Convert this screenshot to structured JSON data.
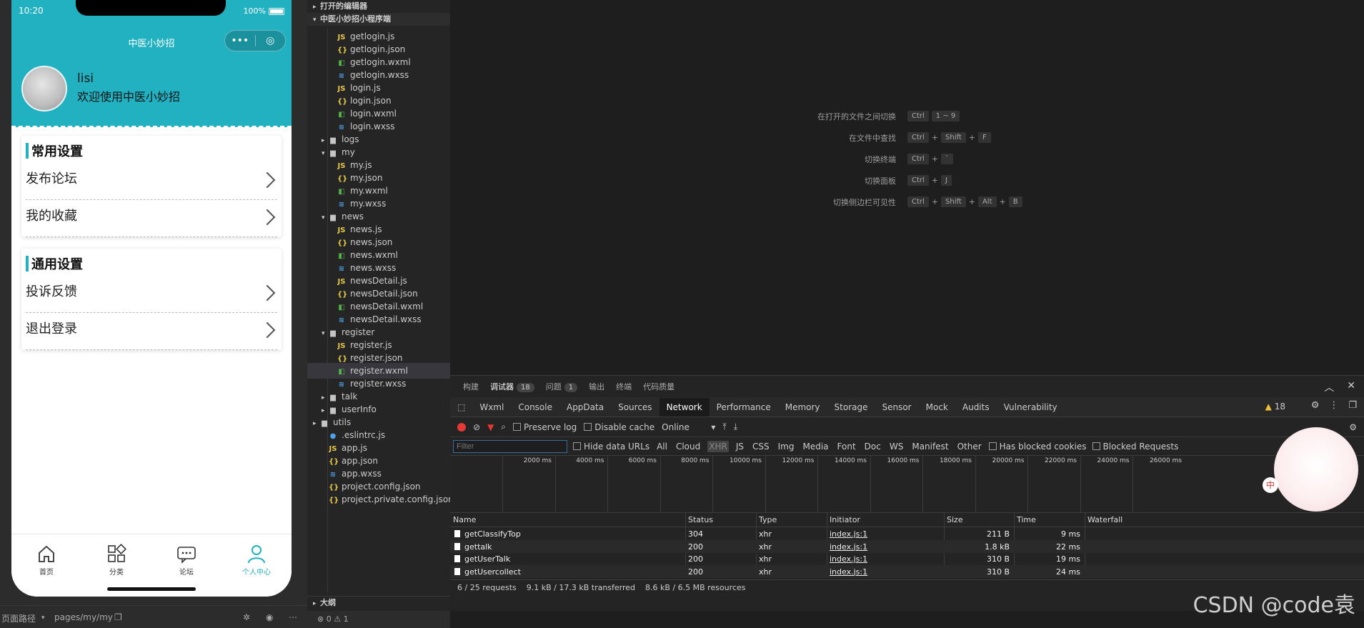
{
  "status_bar": {
    "time": "10:20",
    "battery": "100%"
  },
  "nav": {
    "title": "中医小妙招"
  },
  "profile": {
    "username": "lisi",
    "welcome": "欢迎使用中医小妙招"
  },
  "sections": [
    {
      "title": "常用设置",
      "items": [
        "发布论坛",
        "我的收藏"
      ]
    },
    {
      "title": "通用设置",
      "items": [
        "投诉反馈",
        "退出登录"
      ]
    }
  ],
  "tabs": [
    {
      "label": "首页",
      "icon": "home-icon"
    },
    {
      "label": "分类",
      "icon": "category-icon"
    },
    {
      "label": "论坛",
      "icon": "forum-icon"
    },
    {
      "label": "个人中心",
      "icon": "user-icon",
      "active": true
    }
  ],
  "sim_footer": {
    "path_label": "页面路径",
    "path": "pages/my/my"
  },
  "explorer": {
    "open_editors": "打开的编辑器",
    "project": "中医小妙招小程序端",
    "outline": "大纲",
    "items": [
      {
        "name": "getlogin.js",
        "type": "js",
        "indent": 2
      },
      {
        "name": "getlogin.json",
        "type": "json",
        "indent": 2
      },
      {
        "name": "getlogin.wxml",
        "type": "wxml",
        "indent": 2
      },
      {
        "name": "getlogin.wxss",
        "type": "wxss",
        "indent": 2
      },
      {
        "name": "login.js",
        "type": "js",
        "indent": 2
      },
      {
        "name": "login.json",
        "type": "json",
        "indent": 2
      },
      {
        "name": "login.wxml",
        "type": "wxml",
        "indent": 2
      },
      {
        "name": "login.wxss",
        "type": "wxss",
        "indent": 2
      },
      {
        "name": "logs",
        "type": "folder",
        "indent": 1,
        "open": false
      },
      {
        "name": "my",
        "type": "folder",
        "indent": 1,
        "open": true
      },
      {
        "name": "my.js",
        "type": "js",
        "indent": 2
      },
      {
        "name": "my.json",
        "type": "json",
        "indent": 2
      },
      {
        "name": "my.wxml",
        "type": "wxml",
        "indent": 2
      },
      {
        "name": "my.wxss",
        "type": "wxss",
        "indent": 2
      },
      {
        "name": "news",
        "type": "folder",
        "indent": 1,
        "open": true
      },
      {
        "name": "news.js",
        "type": "js",
        "indent": 2
      },
      {
        "name": "news.json",
        "type": "json",
        "indent": 2
      },
      {
        "name": "news.wxml",
        "type": "wxml",
        "indent": 2
      },
      {
        "name": "news.wxss",
        "type": "wxss",
        "indent": 2
      },
      {
        "name": "newsDetail.js",
        "type": "js",
        "indent": 2
      },
      {
        "name": "newsDetail.json",
        "type": "json",
        "indent": 2
      },
      {
        "name": "newsDetail.wxml",
        "type": "wxml",
        "indent": 2
      },
      {
        "name": "newsDetail.wxss",
        "type": "wxss",
        "indent": 2
      },
      {
        "name": "register",
        "type": "folder",
        "indent": 1,
        "open": true
      },
      {
        "name": "register.js",
        "type": "js",
        "indent": 2
      },
      {
        "name": "register.json",
        "type": "json",
        "indent": 2
      },
      {
        "name": "register.wxml",
        "type": "wxml",
        "indent": 2,
        "selected": true
      },
      {
        "name": "register.wxss",
        "type": "wxss",
        "indent": 2
      },
      {
        "name": "talk",
        "type": "folder",
        "indent": 1,
        "open": false
      },
      {
        "name": "userInfo",
        "type": "folder",
        "indent": 1,
        "open": false
      },
      {
        "name": "utils",
        "type": "folder",
        "indent": 0,
        "open": false
      },
      {
        "name": ".eslintrc.js",
        "type": "eslint",
        "indent": 1
      },
      {
        "name": "app.js",
        "type": "js",
        "indent": 1
      },
      {
        "name": "app.json",
        "type": "json",
        "indent": 1
      },
      {
        "name": "app.wxss",
        "type": "wxss",
        "indent": 1
      },
      {
        "name": "project.config.json",
        "type": "json",
        "indent": 1
      },
      {
        "name": "project.private.config.json",
        "type": "json",
        "indent": 1
      }
    ],
    "footer": "⊗ 0 ⚠ 1"
  },
  "shortcuts": [
    {
      "label": "在打开的文件之间切换",
      "keys": [
        "Ctrl",
        "1 ~ 9"
      ]
    },
    {
      "label": "在文件中查找",
      "keys": [
        "Ctrl",
        "+",
        "Shift",
        "+",
        "F"
      ]
    },
    {
      "label": "切换终端",
      "keys": [
        "Ctrl",
        "+",
        "`"
      ]
    },
    {
      "label": "切换面板",
      "keys": [
        "Ctrl",
        "+",
        "J"
      ]
    },
    {
      "label": "切换侧边栏可见性",
      "keys": [
        "Ctrl",
        "+",
        "Shift",
        "+",
        "Alt",
        "+",
        "B"
      ]
    }
  ],
  "devtools": {
    "top_tabs": [
      "构建",
      "调试器",
      "问题",
      "输出",
      "终端",
      "代码质量"
    ],
    "debugger_count": "18",
    "issues_count": "1",
    "panel_tabs": [
      "Wxml",
      "Console",
      "AppData",
      "Sources",
      "Network",
      "Performance",
      "Memory",
      "Storage",
      "Sensor",
      "Mock",
      "Audits",
      "Vulnerability"
    ],
    "active_panel": "Network",
    "warnings": "18",
    "preserve_log": "Preserve log",
    "disable_cache": "Disable cache",
    "throttle": "Online",
    "filter_placeholder": "Filter",
    "hide_data_urls": "Hide data URLs",
    "types": [
      "All",
      "Cloud",
      "XHR",
      "JS",
      "CSS",
      "Img",
      "Media",
      "Font",
      "Doc",
      "WS",
      "Manifest",
      "Other"
    ],
    "has_blocked": "Has blocked cookies",
    "blocked_requests": "Blocked Requests",
    "ticks": [
      "2000 ms",
      "4000 ms",
      "6000 ms",
      "8000 ms",
      "10000 ms",
      "12000 ms",
      "14000 ms",
      "16000 ms",
      "18000 ms",
      "20000 ms",
      "22000 ms",
      "24000 ms",
      "26000 ms"
    ],
    "columns": [
      "Name",
      "Status",
      "Type",
      "Initiator",
      "Size",
      "Time",
      "Waterfall"
    ],
    "rows": [
      {
        "name": "getClassifyTop",
        "status": "304",
        "type": "xhr",
        "initiator": "index.js:1",
        "size": "211 B",
        "time": "9 ms"
      },
      {
        "name": "gettalk",
        "status": "200",
        "type": "xhr",
        "initiator": "index.js:1",
        "size": "1.8 kB",
        "time": "22 ms"
      },
      {
        "name": "getUserTalk",
        "status": "200",
        "type": "xhr",
        "initiator": "index.js:1",
        "size": "310 B",
        "time": "19 ms"
      },
      {
        "name": "getUsercollect",
        "status": "200",
        "type": "xhr",
        "initiator": "index.js:1",
        "size": "310 B",
        "time": "24 ms"
      }
    ],
    "summary": [
      "6 / 25 requests",
      "9.1 kB / 17.3 kB transferred",
      "8.6 kB / 6.5 MB resources"
    ]
  },
  "mascot_label": "中",
  "watermark": "CSDN @code袁"
}
